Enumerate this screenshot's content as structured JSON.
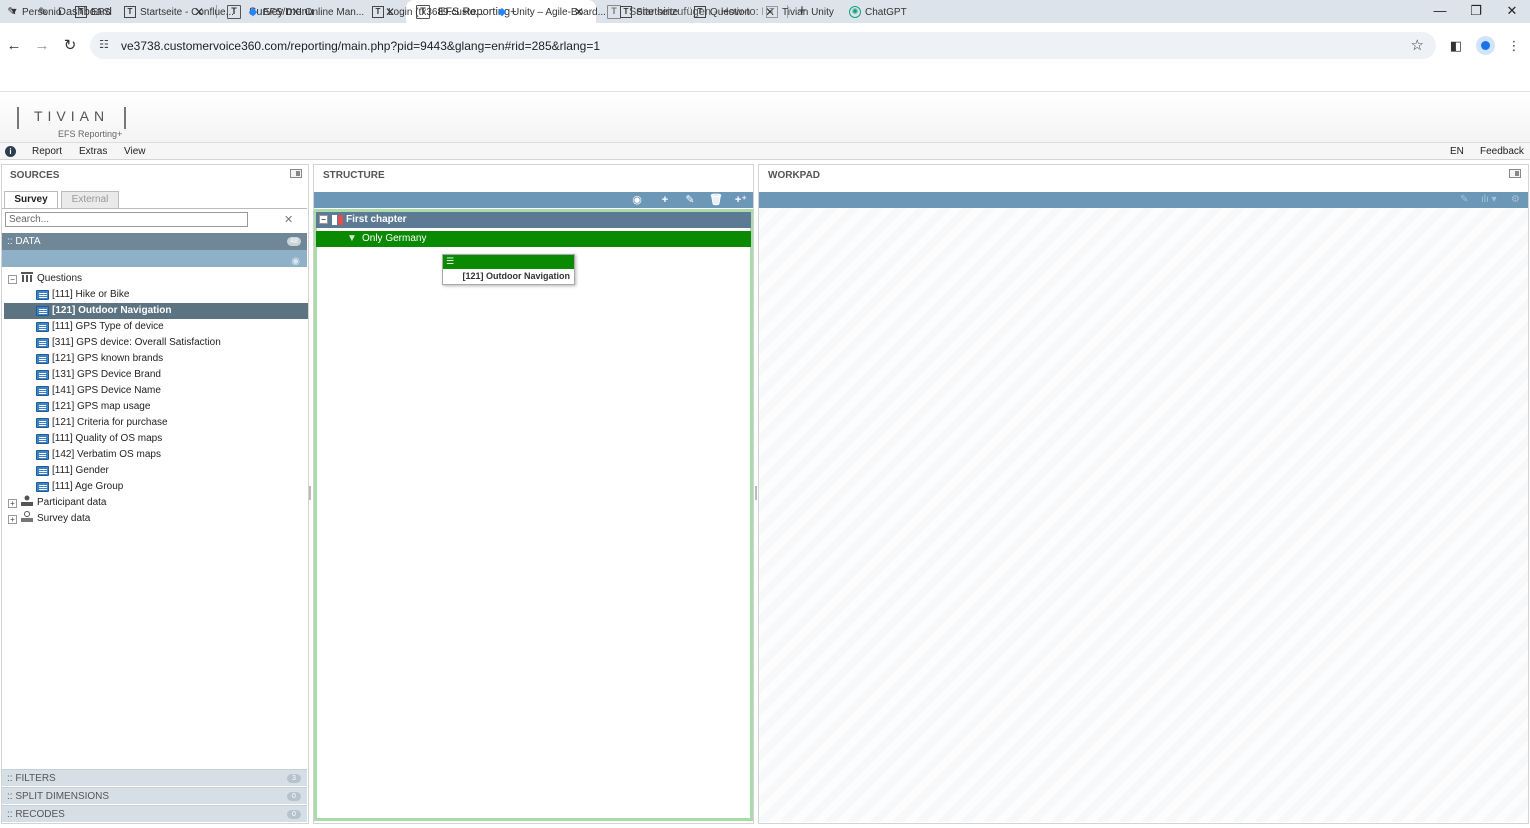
{
  "browser": {
    "tabs": [
      {
        "label": "Dashboard",
        "icon": "pen-icon",
        "glyph": "✎"
      },
      {
        "label": "Survey menu",
        "icon": "tivian-icon",
        "glyph": "T"
      },
      {
        "label": "EFS Reporting+",
        "icon": "tivian-icon",
        "glyph": "T"
      },
      {
        "label": "Seite hinzufügen - How-to: Eval",
        "icon": "tivian-icon",
        "glyph": "T"
      }
    ],
    "url": "ve3738.customervoice360.com/reporting/main.php?pid=9443&glang=en#rid=285&rlang=1",
    "bookmarks": [
      {
        "label": "Personio",
        "icon": "personio-icon"
      },
      {
        "label": "EFS",
        "icon": "tivian-icon"
      },
      {
        "label": "Startseite - Conflue...",
        "icon": "tivian-icon"
      },
      {
        "label": "EFS/DXI Online Man...",
        "icon": "jira-icon"
      },
      {
        "label": "Login (tx3689.custo...",
        "icon": "tivian-icon"
      },
      {
        "label": "Unity – Agile-Board...",
        "icon": "jira-icon"
      },
      {
        "label": "Startseite",
        "icon": "tivian-icon"
      },
      {
        "label": "Question",
        "icon": "tivian-icon"
      },
      {
        "label": "Tivian Unity",
        "icon": "tivian-icon"
      },
      {
        "label": "ChatGPT",
        "icon": "chatgpt-icon"
      }
    ]
  },
  "app": {
    "logo": "TIVIAN",
    "logo_sub": "EFS Reporting+",
    "menu": [
      "Report",
      "Extras",
      "View"
    ],
    "lang": "EN",
    "feedback": "Feedback"
  },
  "sources": {
    "title": "SOURCES",
    "tabs": [
      "Survey",
      "External"
    ],
    "search_placeholder": "Search...",
    "data_label": ":: DATA",
    "data_count": "48",
    "tree": {
      "questions_label": "Questions",
      "items": [
        "[111] Hike or Bike",
        "[121] Outdoor Navigation",
        "[111] GPS Type of device",
        "[311] GPS device: Overall Satisfaction",
        "[121] GPS known brands",
        "[131] GPS Device Brand",
        "[141] GPS Device Name",
        "[121] GPS map usage",
        "[121] Criteria for purchase",
        "[111] Quality of OS maps",
        "[142] Verbatim OS maps",
        "[111] Gender",
        "[111] Age Group"
      ],
      "participant_label": "Participant data",
      "survey_label": "Survey data"
    },
    "filters": {
      "label": ":: FILTERS",
      "count": "3"
    },
    "split": {
      "label": ":: SPLIT DIMENSIONS",
      "count": "0"
    },
    "recodes": {
      "label": ":: RECODES",
      "count": "0"
    }
  },
  "structure": {
    "title": "STRUCTURE",
    "chapter": "First chapter",
    "filter": "Only Germany",
    "drag_item": "[121] Outdoor Navigation"
  },
  "workpad": {
    "title": "WORKPAD"
  },
  "colors": {
    "accent_bar": "#6d97b7",
    "filter_green": "#0a8a00",
    "selection": "#5c7482"
  }
}
